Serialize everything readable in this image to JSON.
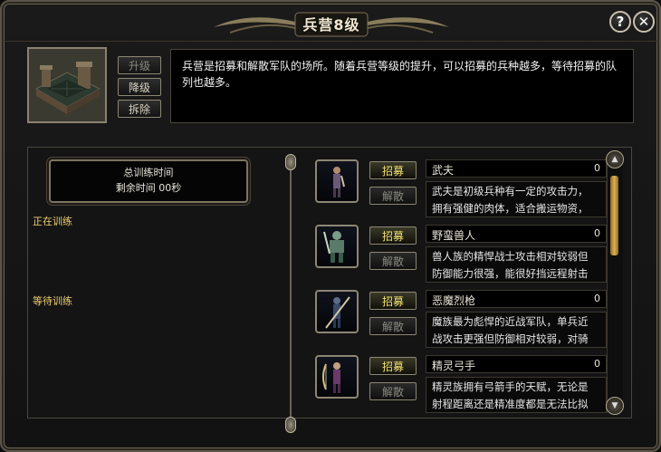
{
  "window": {
    "title": "兵营8级",
    "help_icon": "?",
    "close_icon": "✕"
  },
  "building": {
    "actions": [
      {
        "label": "升级",
        "enabled": false
      },
      {
        "label": "降级",
        "enabled": true
      },
      {
        "label": "拆除",
        "enabled": true
      }
    ],
    "description": "兵营是招募和解散军队的场所。随着兵营等级的提升，可以招募的兵种越多，等待招募的队列也越多。"
  },
  "training": {
    "total_title": "总训练时间",
    "remaining": "剩余时间 00秒",
    "training_label": "正在训练",
    "waiting_label": "等待训练"
  },
  "units": [
    {
      "name": "武夫",
      "count": "0",
      "recruit": "招募",
      "disband": "解散",
      "desc_line1": "武夫是初级兵种有一定的攻击力，",
      "desc_line2": "拥有强健的肉体，适合搬运物资，",
      "icon": "warrior-icon"
    },
    {
      "name": "野蛮兽人",
      "count": "0",
      "recruit": "招募",
      "disband": "解散",
      "desc_line1": "兽人族的精悍战士攻击相对较弱但",
      "desc_line2": "防御能力很强，能很好挡远程射击",
      "icon": "orc-icon"
    },
    {
      "name": "恶魔烈枪",
      "count": "0",
      "recruit": "招募",
      "disband": "解散",
      "desc_line1": "魔族最为彪悍的近战军队，单兵近",
      "desc_line2": "战攻击更强但防御相对较弱，对骑",
      "icon": "demon-lancer-icon"
    },
    {
      "name": "精灵弓手",
      "count": "0",
      "recruit": "招募",
      "disband": "解散",
      "desc_line1": "精灵族拥有弓箭手的天赋，无论是",
      "desc_line2": "射程距离还是精准度都是无法比拟",
      "icon": "elf-archer-icon"
    }
  ],
  "colors": {
    "accent_gold": "#f0e070",
    "label_yellow": "#f0d070",
    "frame": "#8c8674"
  }
}
